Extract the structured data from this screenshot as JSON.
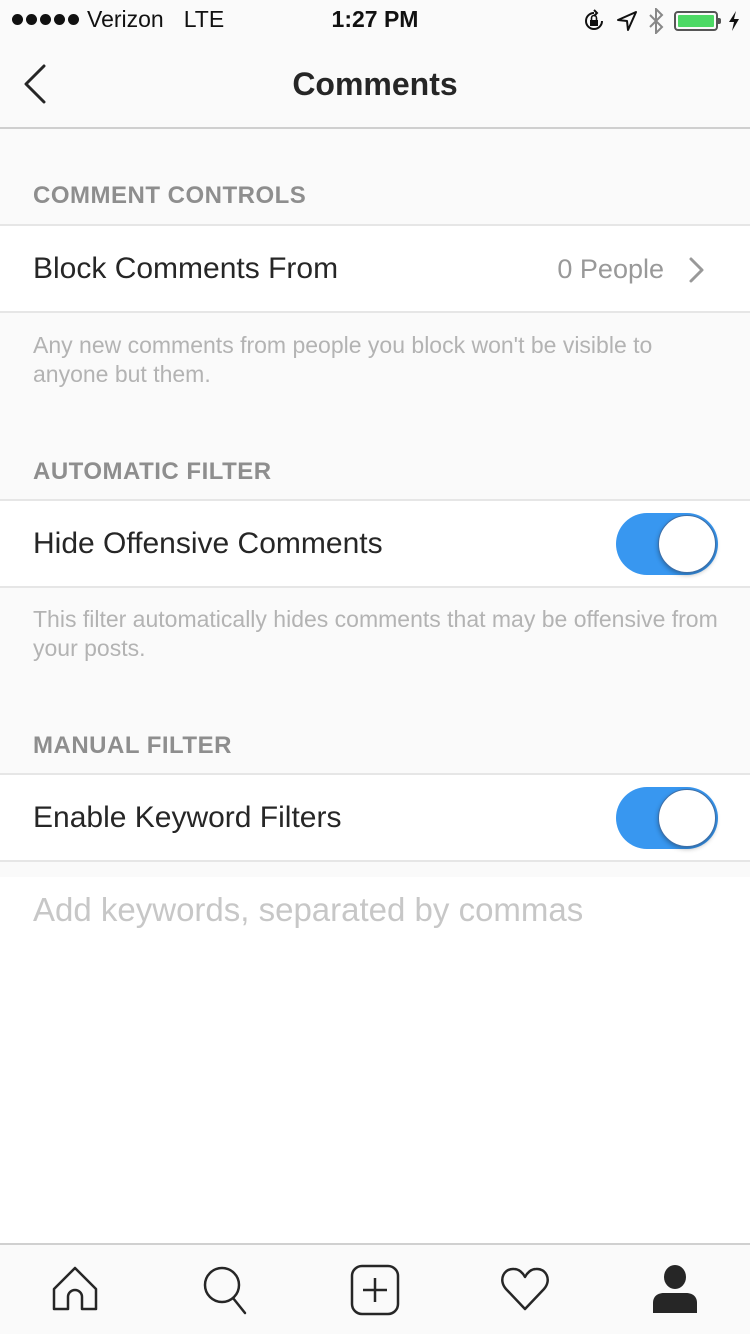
{
  "status_bar": {
    "carrier": "Verizon",
    "network": "LTE",
    "time": "1:27 PM",
    "battery_level": 1.0,
    "icons": [
      "signal-dots-icon",
      "orientation-lock-icon",
      "location-arrow-icon",
      "bluetooth-icon",
      "battery-icon",
      "charging-bolt-icon"
    ]
  },
  "nav": {
    "title": "Comments",
    "back_icon": "chevron-left-icon"
  },
  "sections": {
    "comment_controls": {
      "header": "COMMENT CONTROLS",
      "row_label": "Block Comments From",
      "row_value": "0 People",
      "description": "Any new comments from people you block won't be visible to anyone but them."
    },
    "automatic_filter": {
      "header": "AUTOMATIC FILTER",
      "row_label": "Hide Offensive Comments",
      "toggle_on": true,
      "description": "This filter automatically hides comments that may be offensive from your posts."
    },
    "manual_filter": {
      "header": "MANUAL FILTER",
      "row_label": "Enable Keyword Filters",
      "toggle_on": true,
      "keywords_value": "",
      "keywords_placeholder": "Add keywords, separated by commas"
    }
  },
  "tab_bar": {
    "tabs": [
      {
        "name": "home",
        "icon": "home-icon"
      },
      {
        "name": "search",
        "icon": "search-icon"
      },
      {
        "name": "new-post",
        "icon": "plus-square-icon"
      },
      {
        "name": "activity",
        "icon": "heart-icon"
      },
      {
        "name": "profile",
        "icon": "profile-icon",
        "active": true
      }
    ]
  },
  "colors": {
    "accent": "#3897f0",
    "battery": "#4cd964",
    "text_primary": "#262626",
    "text_secondary": "#8e8e8e"
  }
}
